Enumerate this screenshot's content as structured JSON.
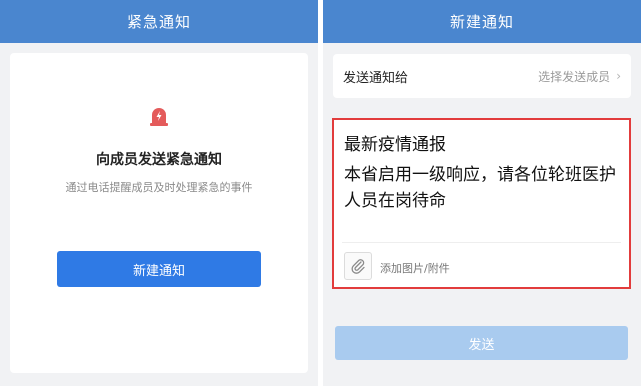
{
  "left_screen": {
    "header_title": "紧急通知",
    "card": {
      "icon": "alarm-light-icon",
      "title": "向成员发送紧急通知",
      "subtitle": "通过电话提醒成员及时处理紧急的事件",
      "button_label": "新建通知"
    }
  },
  "right_screen": {
    "header_title": "新建通知",
    "recipient": {
      "label": "发送通知给",
      "placeholder": "选择发送成员",
      "chevron_icon": "chevron-right-icon"
    },
    "compose": {
      "title": "最新疫情通报",
      "body": "本省启用一级响应，请各位轮班医护人员在岗待命",
      "attach_icon": "paperclip-icon",
      "attach_label": "添加图片/附件"
    },
    "send_button_label": "发送"
  },
  "colors": {
    "header_blue": "#4a86cf",
    "primary_blue": "#2f7ae5",
    "disabled_blue": "#a9cbef",
    "alert_red": "#e45b5b",
    "highlight_border": "#e23c3c"
  }
}
